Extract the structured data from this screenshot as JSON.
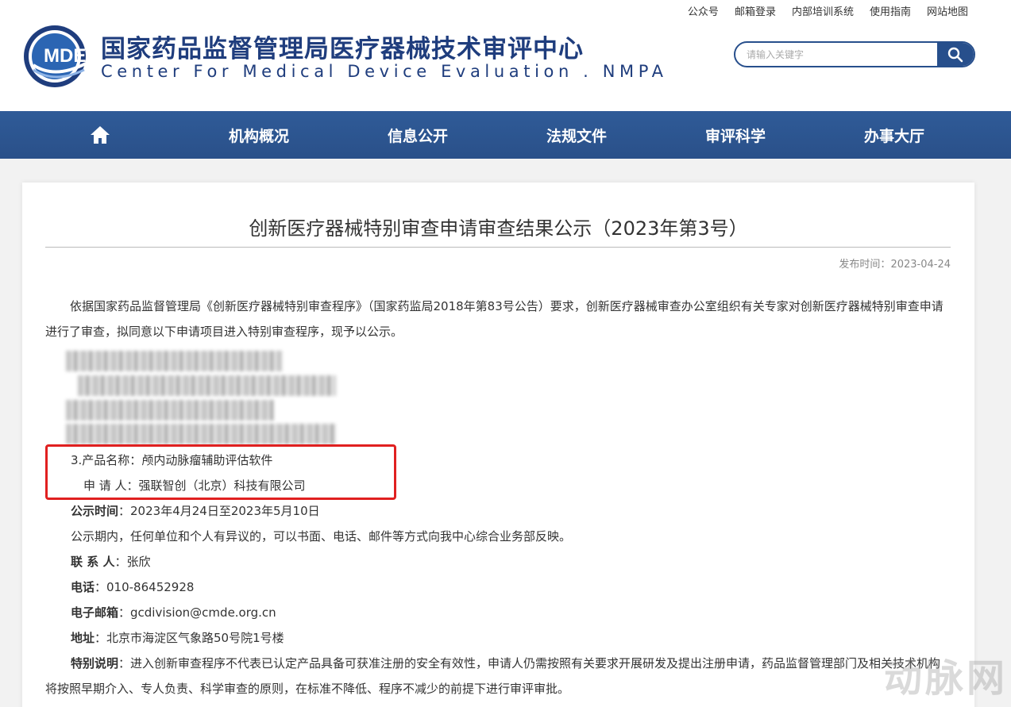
{
  "header": {
    "top_links": [
      "公众号",
      "邮箱登录",
      "内部培训系统",
      "使用指南",
      "网站地图"
    ],
    "logo_text": "MDE",
    "site_title": "国家药品监督管理局医疗器械技术审评中心",
    "site_subtitle": "Center For Medical Device Evaluation . NMPA",
    "search": {
      "placeholder": "请输入关键字",
      "icon": "search-icon"
    }
  },
  "nav": {
    "home_icon": "home-icon",
    "items": [
      "机构概况",
      "信息公开",
      "法规文件",
      "审评科学",
      "办事大厅"
    ]
  },
  "article": {
    "title": "创新医疗器械特别审查申请审查结果公示（2023年第3号）",
    "date_label": "发布时间：",
    "date": "2023-04-24",
    "intro": "依据国家药品监督管理局《创新医疗器械特别审查程序》（国家药监局2018年第83号公告）要求，创新医疗器械审查办公室组织有关专家对创新医疗器械特别审查申请进行了审查，拟同意以下申请项目进入特别审查程序，现予以公示。",
    "product3_label": "3.产品名称：",
    "product3_name": "颅内动脉瘤辅助评估软件",
    "applicant_label": "申 请 人：",
    "applicant": "强联智创（北京）科技有限公司",
    "period_label": "公示时间",
    "period": "：2023年4月24日至2023年5月10日",
    "objection": "公示期内，任何单位和个人有异议的，可以书面、电话、邮件等方式向我中心综合业务部反映。",
    "contact_label": "联 系 人",
    "contact": "：张欣",
    "phone_label": "电话",
    "phone": "：010-86452928",
    "email_label": "电子邮箱",
    "email": "：gcdivision@cmde.org.cn",
    "address_label": "地址",
    "address": "：北京市海淀区气象路50号院1号楼",
    "note_label": "特别说明",
    "note": "：进入创新审查程序不代表已认定产品具备可获准注册的安全有效性，申请人仍需按照有关要求开展研发及提出注册申请，药品监督管理部门及相关技术机构将按照早期介入、专人负责、科学审查的原则，在标准不降低、程序不减少的前提下进行审评审批。"
  },
  "watermark": "动脉网",
  "colors": {
    "brand_blue": "#274f8c",
    "nav_blue": "#2c5490",
    "highlight_red": "#e02020"
  }
}
